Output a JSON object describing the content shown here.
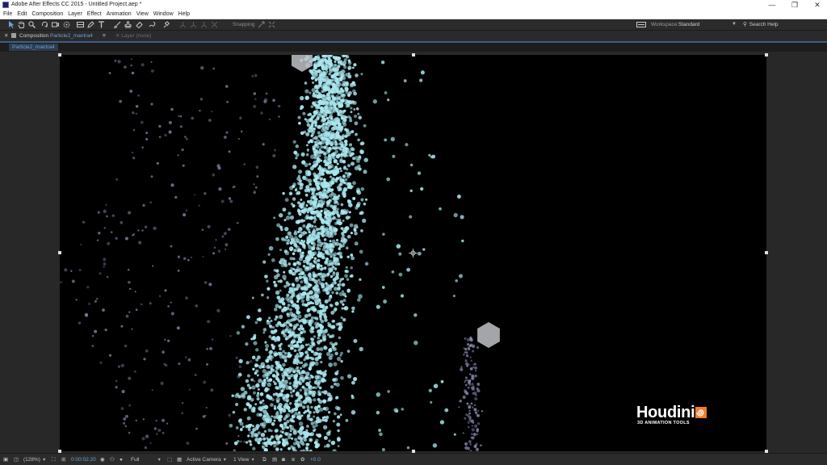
{
  "window": {
    "title": "Adobe After Effects CC 2015 - Untitled Project.aep *",
    "minimize_glyph": "—",
    "maximize_glyph": "❐",
    "close_glyph": "✕"
  },
  "menu": [
    "File",
    "Edit",
    "Composition",
    "Layer",
    "Effect",
    "Animation",
    "View",
    "Window",
    "Help"
  ],
  "toolbar": {
    "tools": [
      "selection-tool-icon",
      "hand-tool-icon",
      "zoom-tool-icon",
      "rotation-tool-icon",
      "camera-tool-icon",
      "pan-behind-icon",
      "rectangle-tool-icon",
      "pen-tool-icon",
      "type-tool-icon",
      "brush-tool-icon",
      "clone-stamp-icon",
      "eraser-icon",
      "roto-brush-icon",
      "puppet-pin-icon"
    ],
    "snapping_label": "Snapping",
    "workspace_label": "Workspace:",
    "workspace_value": "Standard",
    "search_placeholder": "Search Help"
  },
  "panel_tabs": {
    "composition_prefix": "Composition",
    "composition_name": "Particle2_mantra4",
    "layer_tab": "Layer (none)"
  },
  "subtab": "Particle2_mantra4",
  "logo": {
    "word": "Houdini",
    "tagline": "3D ANIMATION TOOLS"
  },
  "bottom_bar": {
    "zoom": "(128%)",
    "timecode": "0:00:02:20",
    "resolution": "Full",
    "camera": "Active Camera",
    "views": "1 View",
    "exposure": "+0.0"
  },
  "colors": {
    "particle": "#a8e6ee",
    "particle_dim": "#8f90b8",
    "accent_blue": "#6aa4d8",
    "logo_orange": "#f07d2c"
  }
}
